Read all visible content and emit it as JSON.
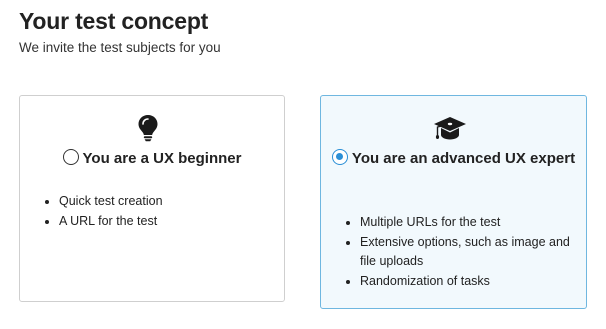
{
  "header": {
    "title": "Your test concept",
    "subtitle": "We invite the test subjects for you"
  },
  "options": [
    {
      "id": "beginner",
      "icon": "lightbulb-icon",
      "label": "You are a UX beginner",
      "selected": false,
      "features": [
        "Quick test creation",
        "A URL for the test"
      ]
    },
    {
      "id": "expert",
      "icon": "graduation-cap-icon",
      "label": "You are an advanced UX expert",
      "selected": true,
      "features": [
        "Multiple URLs for the test",
        "Extensive options, such as image and file uploads",
        "Randomization of tasks"
      ]
    }
  ],
  "colors": {
    "accent": "#2b8fd6",
    "selected_border": "#6fb7e0",
    "selected_background": "#f2f9fd",
    "card_border": "#cfcfcf",
    "text": "#222222"
  }
}
